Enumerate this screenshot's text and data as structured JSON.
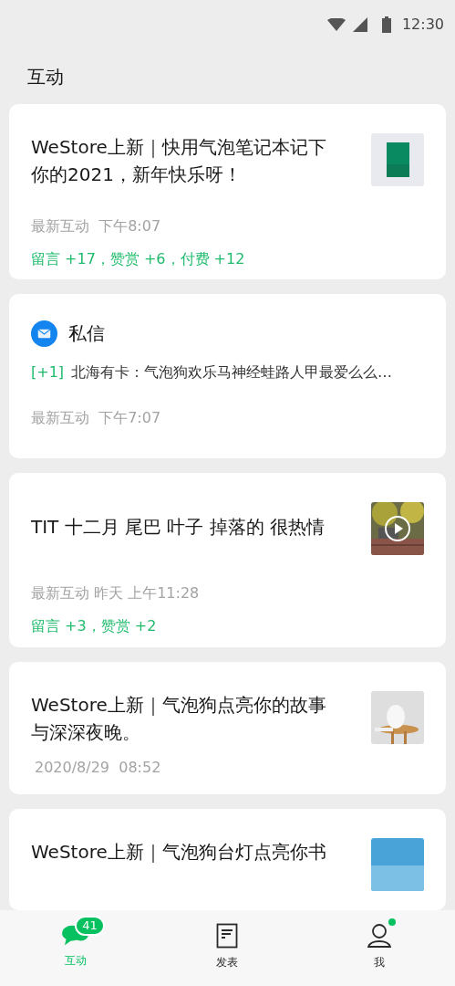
{
  "status_bar": {
    "time": "12:30"
  },
  "title": "互动",
  "cards": [
    {
      "kind": "article",
      "title": "WeStore上新｜快用气泡笔记本记下你的2021，新年快乐呀！",
      "video": false,
      "time": "最新互动  下午8:07",
      "stats": "留言 +17，赞赏 +6，付费 +12"
    },
    {
      "kind": "message",
      "heading": "私信",
      "badge": "[+1]",
      "preview": "北海有卡：气泡狗欢乐马神经蛙路人甲最爱么么…",
      "time": "最新互动  下午7:07"
    },
    {
      "kind": "article",
      "title": "TIT 十二月 尾巴 叶子 掉落的 很热情",
      "video": true,
      "time": "最新互动 昨天 上午11:28",
      "stats": "留言 +3，赞赏 +2"
    },
    {
      "kind": "article",
      "title": "WeStore上新｜气泡狗点亮你的故事与深深夜晚。",
      "video": false,
      "time": "2020/8/29  08:52"
    },
    {
      "kind": "article",
      "title": "WeStore上新｜气泡狗台灯点亮你书",
      "video": false
    }
  ],
  "tabs": [
    {
      "label": "互动",
      "selected": true,
      "badge": "41"
    },
    {
      "label": "发表",
      "selected": false
    },
    {
      "label": "我",
      "selected": false,
      "dot": true
    }
  ]
}
